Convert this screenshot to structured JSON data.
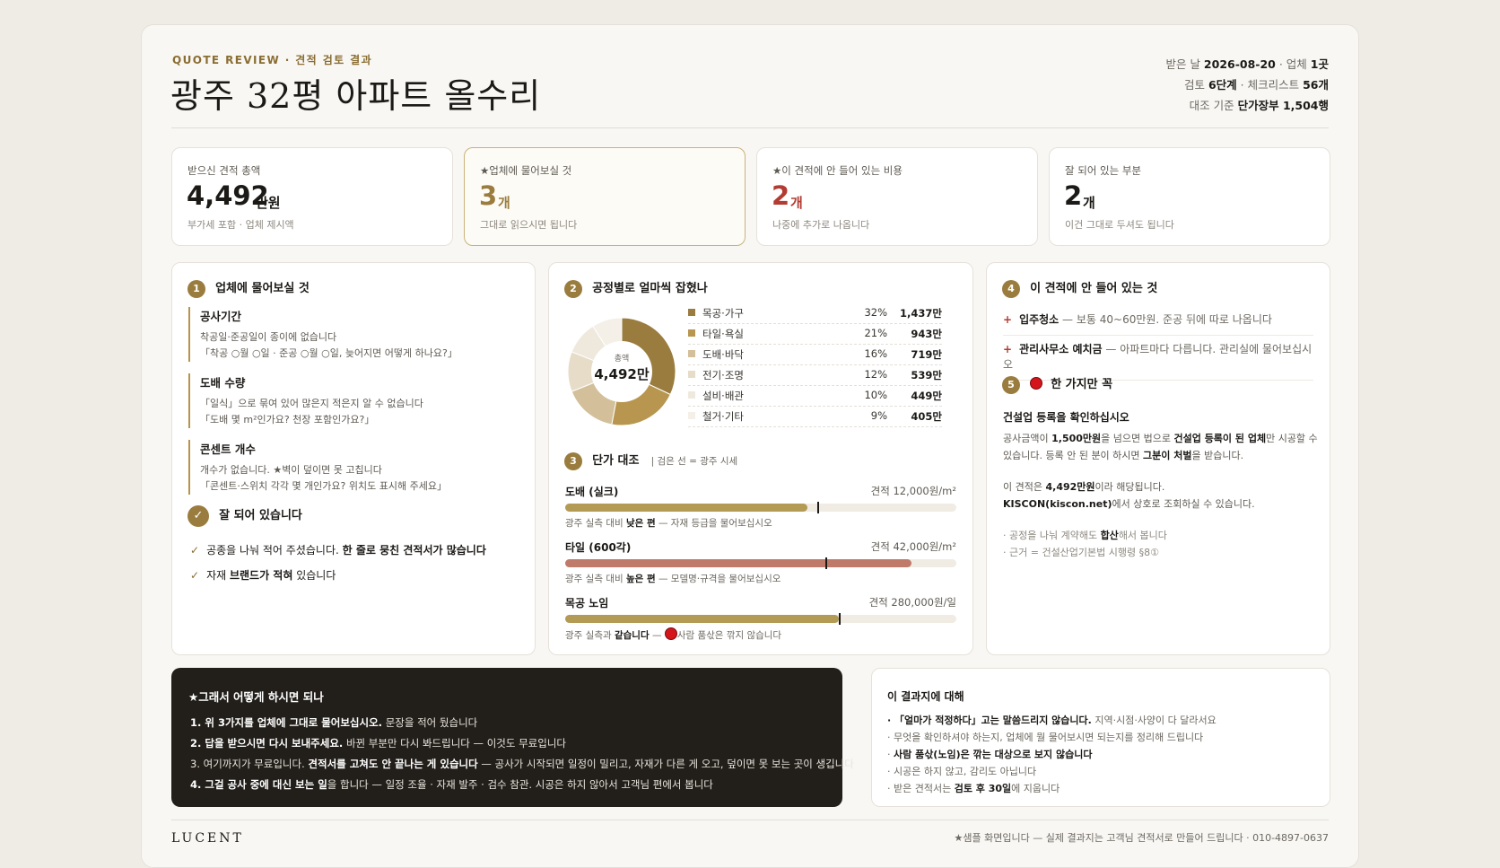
{
  "header": {
    "eyebrow": "QUOTE REVIEW · 견적 검토 결과",
    "title": "광주 32평 아파트 올수리",
    "meta_received_label": "받은 날 ",
    "meta_received_date": "2026-08-20",
    "meta_vendor_label": " · 업체 ",
    "meta_vendor_count": "1곳",
    "meta_review_label": "검토 ",
    "meta_review_steps": "6단계",
    "meta_checklist_label": " · 체크리스트 ",
    "meta_checklist_count": "56개",
    "meta_basis_label": "대조 기준 ",
    "meta_basis_value": "단가장부 1,504행"
  },
  "stats": [
    {
      "label": "받으신 견적 총액",
      "value": "4,492",
      "unit": "만원",
      "sub": "부가세 포함 · 업체 제시액",
      "color": "#1c1a17"
    },
    {
      "label": "★업체에 물어보실 것",
      "value": "3",
      "unit": "개",
      "sub": "그대로 읽으시면 됩니다",
      "color": "#9a7c3e"
    },
    {
      "label": "★이 견적에 안 들어 있는 비용",
      "value": "2",
      "unit": "개",
      "sub": "나중에 추가로 나옵니다",
      "color": "#b23c32"
    },
    {
      "label": "잘 되어 있는 부분",
      "value": "2",
      "unit": "개",
      "sub": "이건 그대로 두셔도 됩니다",
      "color": "#1c1a17"
    }
  ],
  "panel1": {
    "num": "1",
    "title": "업체에 물어보실 것",
    "questions": [
      {
        "head": "공사기간",
        "l1": "착공일·준공일이 종이에 없습니다",
        "l2": "「착공 ○월 ○일 · 준공 ○월 ○일, 늦어지면 어떻게 하나요?」"
      },
      {
        "head": "도배 수량",
        "l1": "「일식」으로 묶여 있어 많은지 적은지 알 수 없습니다",
        "l2": "「도배 몇 m²인가요? 천장 포함인가요?」"
      },
      {
        "head": "콘센트 개수",
        "l1": "개수가 없습니다. ★벽이 덮이면 못 고칩니다",
        "l2": "「콘센트·스위치 각각 몇 개인가요? 위치도 표시해 주세요」"
      }
    ],
    "good_title": "잘 되어 있습니다",
    "good1_a": "공종을 나눠 적어 주셨습니다. ",
    "good1_b": "한 줄로 뭉친 견적서가 많습니다",
    "good2_a": "자재 ",
    "good2_b": "브랜드가 적혀",
    "good2_c": " 있습니다"
  },
  "panel2": {
    "num": "2",
    "title": "공정별로 얼마씩 잡혔나",
    "donut_label": "총액",
    "donut_value": "4,492만"
  },
  "chart_data": {
    "type": "pie",
    "title": "공정별로 얼마씩 잡혔나",
    "categories": [
      "목공·가구",
      "타일·욕실",
      "도배·바닥",
      "전기·조명",
      "설비·배관",
      "철거·기타"
    ],
    "percents": [
      "32%",
      "21%",
      "16%",
      "12%",
      "10%",
      "9%"
    ],
    "amounts": [
      "1,437만",
      "943만",
      "719만",
      "539만",
      "449만",
      "405만"
    ],
    "values": [
      1437,
      943,
      719,
      539,
      449,
      405
    ],
    "colors": [
      "#9a7c3e",
      "#b8964f",
      "#d3c09a",
      "#e6dcc7",
      "#efe9dd",
      "#f4f0e8"
    ]
  },
  "panel3": {
    "num": "3",
    "title": "단가 대조",
    "legend": "| 검은 선 = 광주 시세",
    "bars": [
      {
        "name": "도배 (실크)",
        "quote": "견적 12,000원/m²",
        "fill": 0.62,
        "mark": 0.645,
        "color": "#b39a55",
        "note_a": "광주 실측 대비 ",
        "note_b": "낮은 편",
        "note_c": " — 자재 등급을 물어보십시오"
      },
      {
        "name": "타일 (600각)",
        "quote": "견적 42,000원/m²",
        "fill": 0.885,
        "mark": 0.665,
        "color": "#c07a6a",
        "note_a": "광주 실측 대비 ",
        "note_b": "높은 편",
        "note_c": " — 모델명·규격을 물어보십시오"
      },
      {
        "name": "목공 노임",
        "quote": "견적 280,000원/일",
        "fill": 0.7,
        "mark": 0.7,
        "color": "#b39a55",
        "note_a": "광주 실측과 ",
        "note_b": "같습니다",
        "note_c": " — ",
        "note_d": "사람 품삯은 깎지 않습니다"
      }
    ]
  },
  "panel4": {
    "num": "4",
    "title": "이 견적에 안 들어 있는 것",
    "items": [
      {
        "bold": "입주청소",
        "rest": " — 보통 40~60만원. 준공 뒤에 따로 나옵니다"
      },
      {
        "bold": "관리사무소 예치금",
        "rest": " — 아파트마다 다릅니다. 관리실에 물어보십시오"
      }
    ],
    "num5": "5",
    "title5": "한 가지만 꼭",
    "head5": "건설업 등록을 확인하십시오",
    "t1a": "공사금액이 ",
    "t1b": "1,500만원",
    "t1c": "을 넘으면 법으로 ",
    "t1d": "건설업 등록이 된 업체",
    "t1e": "만 시공할 수",
    "t2a": "있습니다. 등록 안 된 분이 하시면 ",
    "t2b": "그분이 처벌",
    "t2c": "을 받습니다.",
    "t3a": "이 견적은 ",
    "t3b": "4,492만원",
    "t3c": "이라 해당됩니다.",
    "t4b": "KISCON(kiscon.net)",
    "t4c": "에서 상호로 조회하실 수 있습니다.",
    "t5a": "· 공정을 나눠 계약해도 ",
    "t5b": "합산",
    "t5c": "해서 봅니다",
    "t6": "· 근거 = 건설산업기본법 시행령 §8①"
  },
  "next_steps": {
    "title": "★그래서 어떻게 하시면 되나",
    "s1a": "1. 위 3가지를 업체에 그대로 물어보십시오.",
    "s1b": " 문장을 적어 뒀습니다",
    "s2a": "2. 답을 받으시면 다시 보내주세요.",
    "s2b": " 바뀐 부분만 다시 봐드립니다 — 이것도 무료입니다",
    "s3a": "3. 여기까지가 무료입니다. ",
    "s3b": "견적서를 고쳐도 안 끝나는 게 있습니다",
    "s3c": " — 공사가 시작되면 일정이 밀리고, 자재가 다른 게 오고, 덮이면 못 보는 곳이 생깁니다",
    "s4a": "4. 그걸 공사 중에 대신 보는 일",
    "s4b": "을 합니다 — 일정 조율 · 자재 발주 · 검수 참관. 시공은 하지 않아서 고객님 편에서 봅니다"
  },
  "about": {
    "title": "이 결과지에 대해",
    "a1a": "· 「얼마가 적정하다」고는 말씀드리지 않습니다.",
    "a1b": " 지역·시점·사양이 다 달라서요",
    "a2": "· 무엇을 확인하셔야 하는지, 업체에 뭘 물어보시면 되는지를 정리해 드립니다",
    "a3a": "· ",
    "a3b": "사람 품삯(노임)은 깎는 대상으로 보지 않습니다",
    "a4": "· 시공은 하지 않고, 감리도 아닙니다",
    "a5a": "· 받은 견적서는 ",
    "a5b": "검토 후 30일",
    "a5c": "에 지웁니다"
  },
  "footer": {
    "brand": "LUCENT",
    "note": "★샘플 화면입니다 — 실제 결과지는 고객님 견적서로 만들어 드립니다 · 010-4897-0637"
  }
}
